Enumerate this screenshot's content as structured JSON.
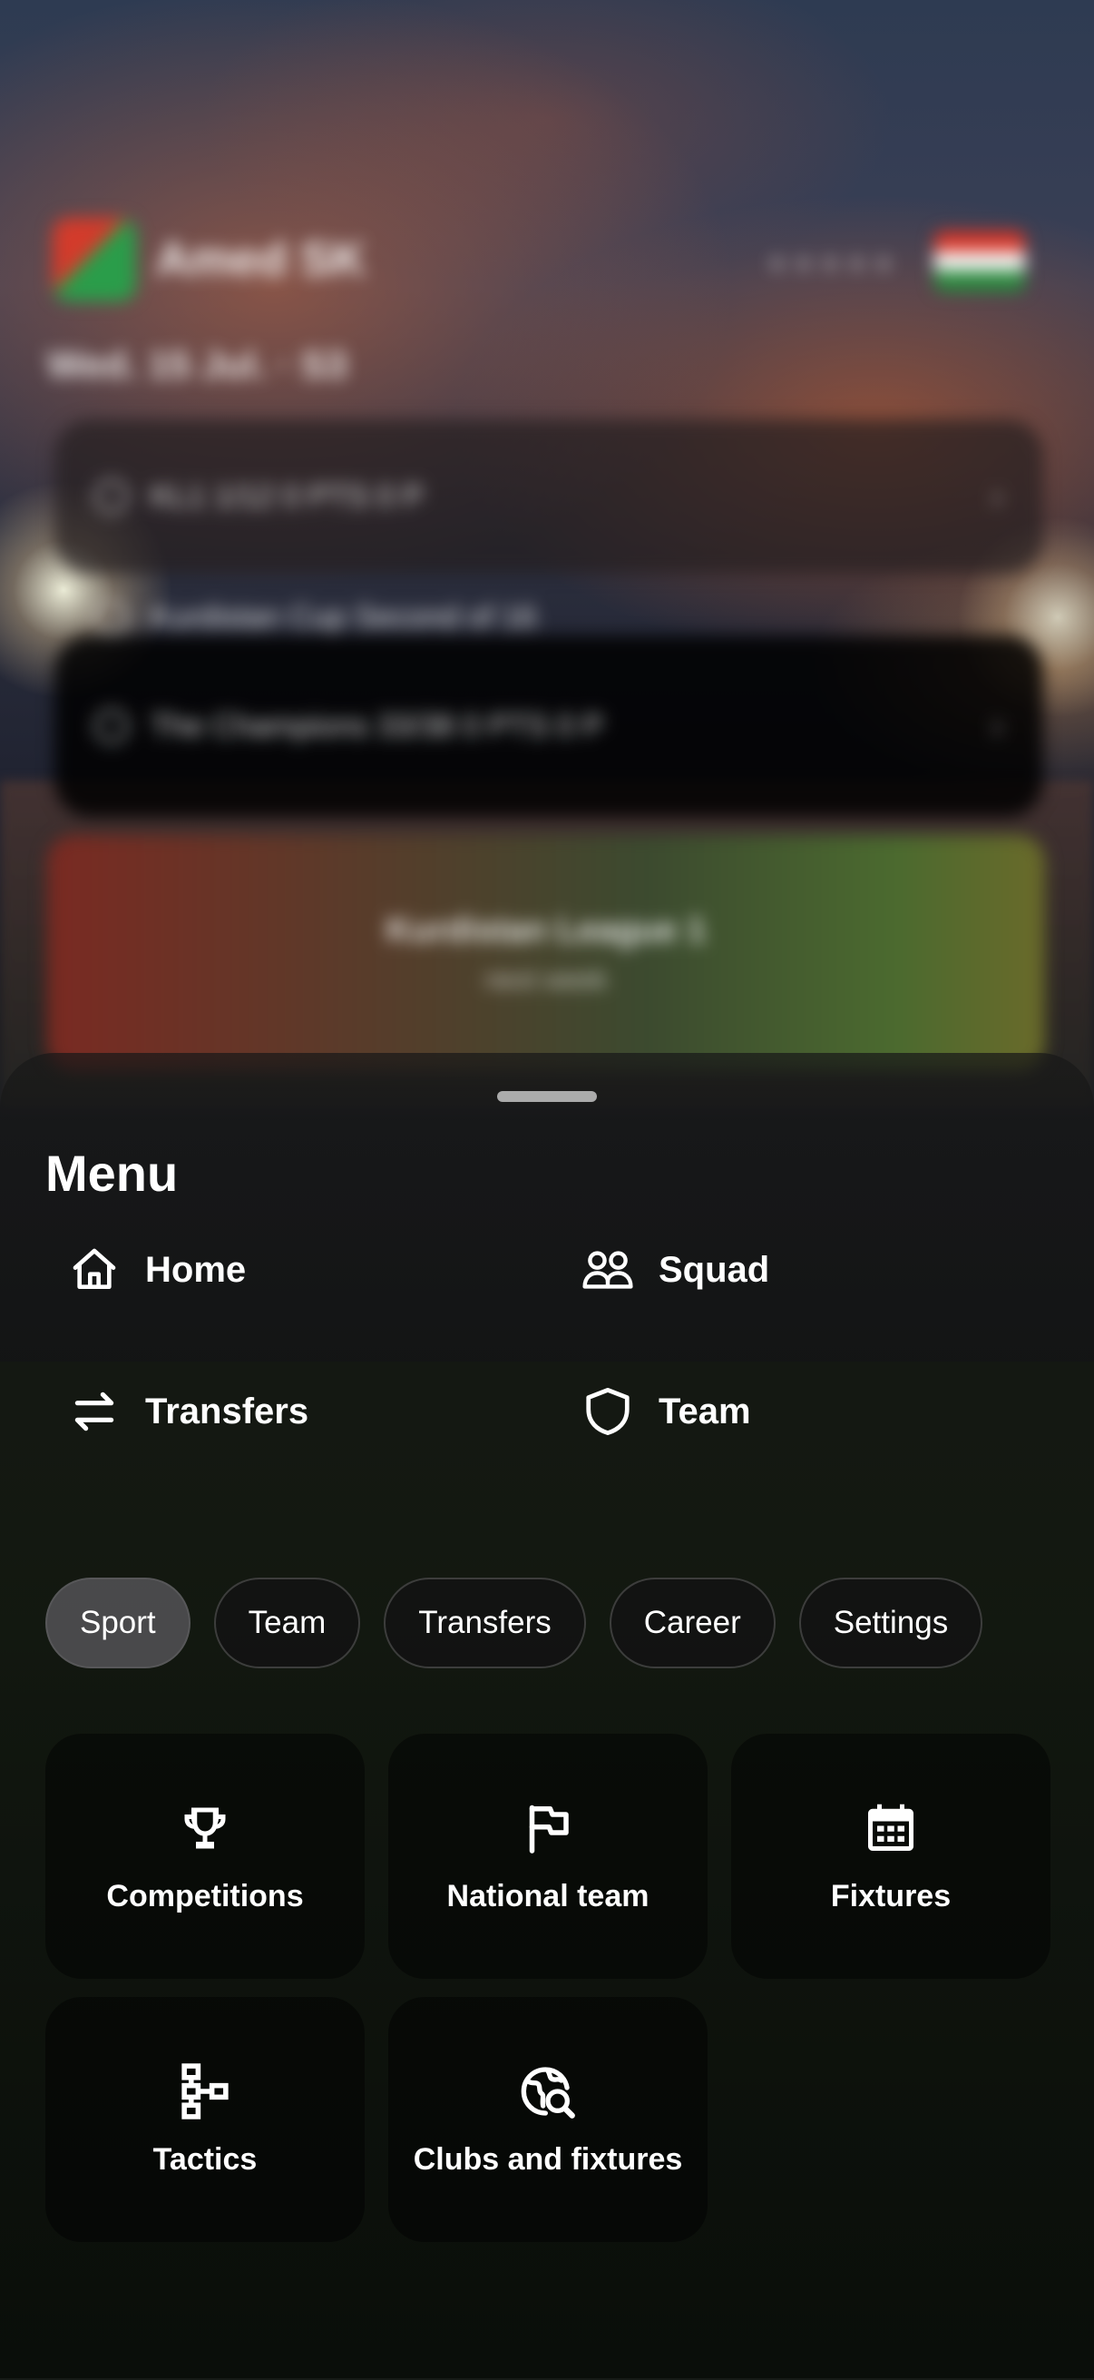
{
  "background": {
    "club_name": "Amed SK",
    "date_line": "Wed. 15 Jul. · S3",
    "stars": "★★★★★",
    "competitions": [
      {
        "label": "KL1  1/12  0 PTS  0 P"
      },
      {
        "label": "Kurdistan Cup  Second of 16"
      },
      {
        "label": "The Champions  33/38  0 PTS  0 P"
      }
    ],
    "banner_title": "Kurdistan League 1",
    "banner_subtitle": "next week",
    "colors": {
      "accent_red": "#d8372a",
      "accent_green": "#2b8a3e"
    }
  },
  "menu": {
    "title": "Menu",
    "quick_links": [
      {
        "label": "Home",
        "icon": "home-icon"
      },
      {
        "label": "Squad",
        "icon": "people-icon"
      },
      {
        "label": "Transfers",
        "icon": "swap-arrows-icon"
      },
      {
        "label": "Team",
        "icon": "shield-icon"
      }
    ],
    "chips": [
      {
        "label": "Sport",
        "active": true
      },
      {
        "label": "Team",
        "active": false
      },
      {
        "label": "Transfers",
        "active": false
      },
      {
        "label": "Career",
        "active": false
      },
      {
        "label": "Settings",
        "active": false
      }
    ],
    "tiles": [
      {
        "label": "Competitions",
        "icon": "trophy-icon"
      },
      {
        "label": "National team",
        "icon": "flag-icon"
      },
      {
        "label": "Fixtures",
        "icon": "calendar-icon"
      },
      {
        "label": "Tactics",
        "icon": "hierarchy-icon"
      },
      {
        "label": "Clubs and fixtures",
        "icon": "globe-search-icon"
      }
    ]
  }
}
